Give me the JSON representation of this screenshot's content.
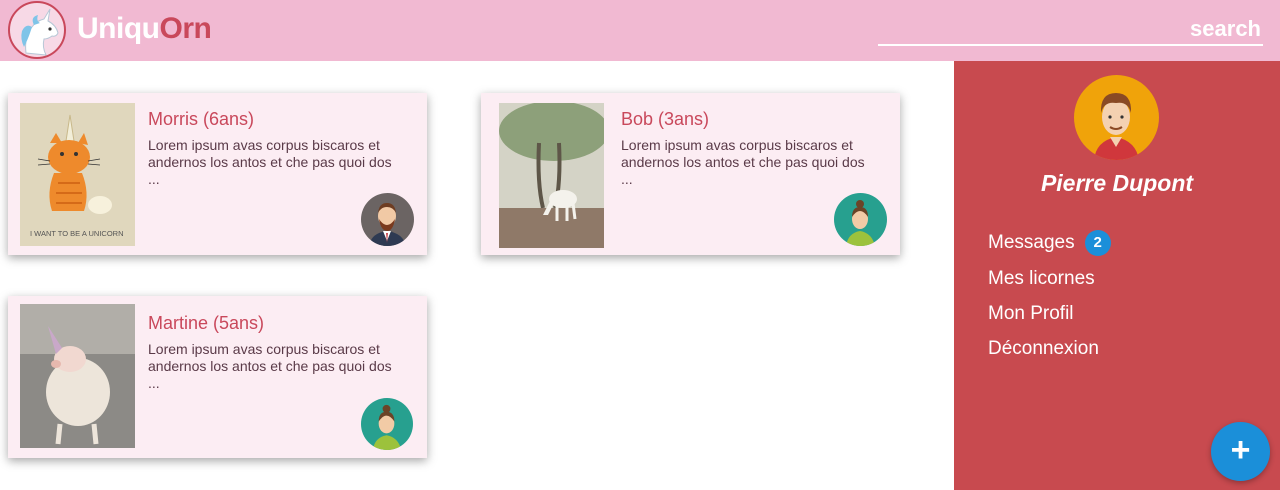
{
  "header": {
    "brand_part1": "Uniqu",
    "brand_part2": "Orn",
    "search_placeholder": "search"
  },
  "cards": [
    {
      "name": "Morris (6ans)",
      "description": "Lorem ipsum avas corpus biscaros et andernos los antos et che pas quoi dos ...",
      "photo_caption": "I WANT TO BE A UNICORN"
    },
    {
      "name": "Bob (3ans)",
      "description": "Lorem ipsum avas corpus biscaros et andernos los antos et che pas quoi dos ..."
    },
    {
      "name": "Martine (5ans)",
      "description": "Lorem ipsum avas corpus biscaros et andernos los antos et che pas quoi dos ..."
    }
  ],
  "sidebar": {
    "user_name": "Pierre Dupont",
    "menu": [
      {
        "label": "Messages",
        "badge": "2"
      },
      {
        "label": "Mes licornes"
      },
      {
        "label": "Mon Profil"
      },
      {
        "label": "Déconnexion"
      }
    ]
  },
  "fab": {
    "label": "+"
  },
  "colors": {
    "header_bg": "#f1b9d2",
    "accent": "#c9485b",
    "sidebar_bg": "#c84a4f",
    "card_bg": "#fcedf3",
    "badge_blue": "#1b8fd9"
  }
}
